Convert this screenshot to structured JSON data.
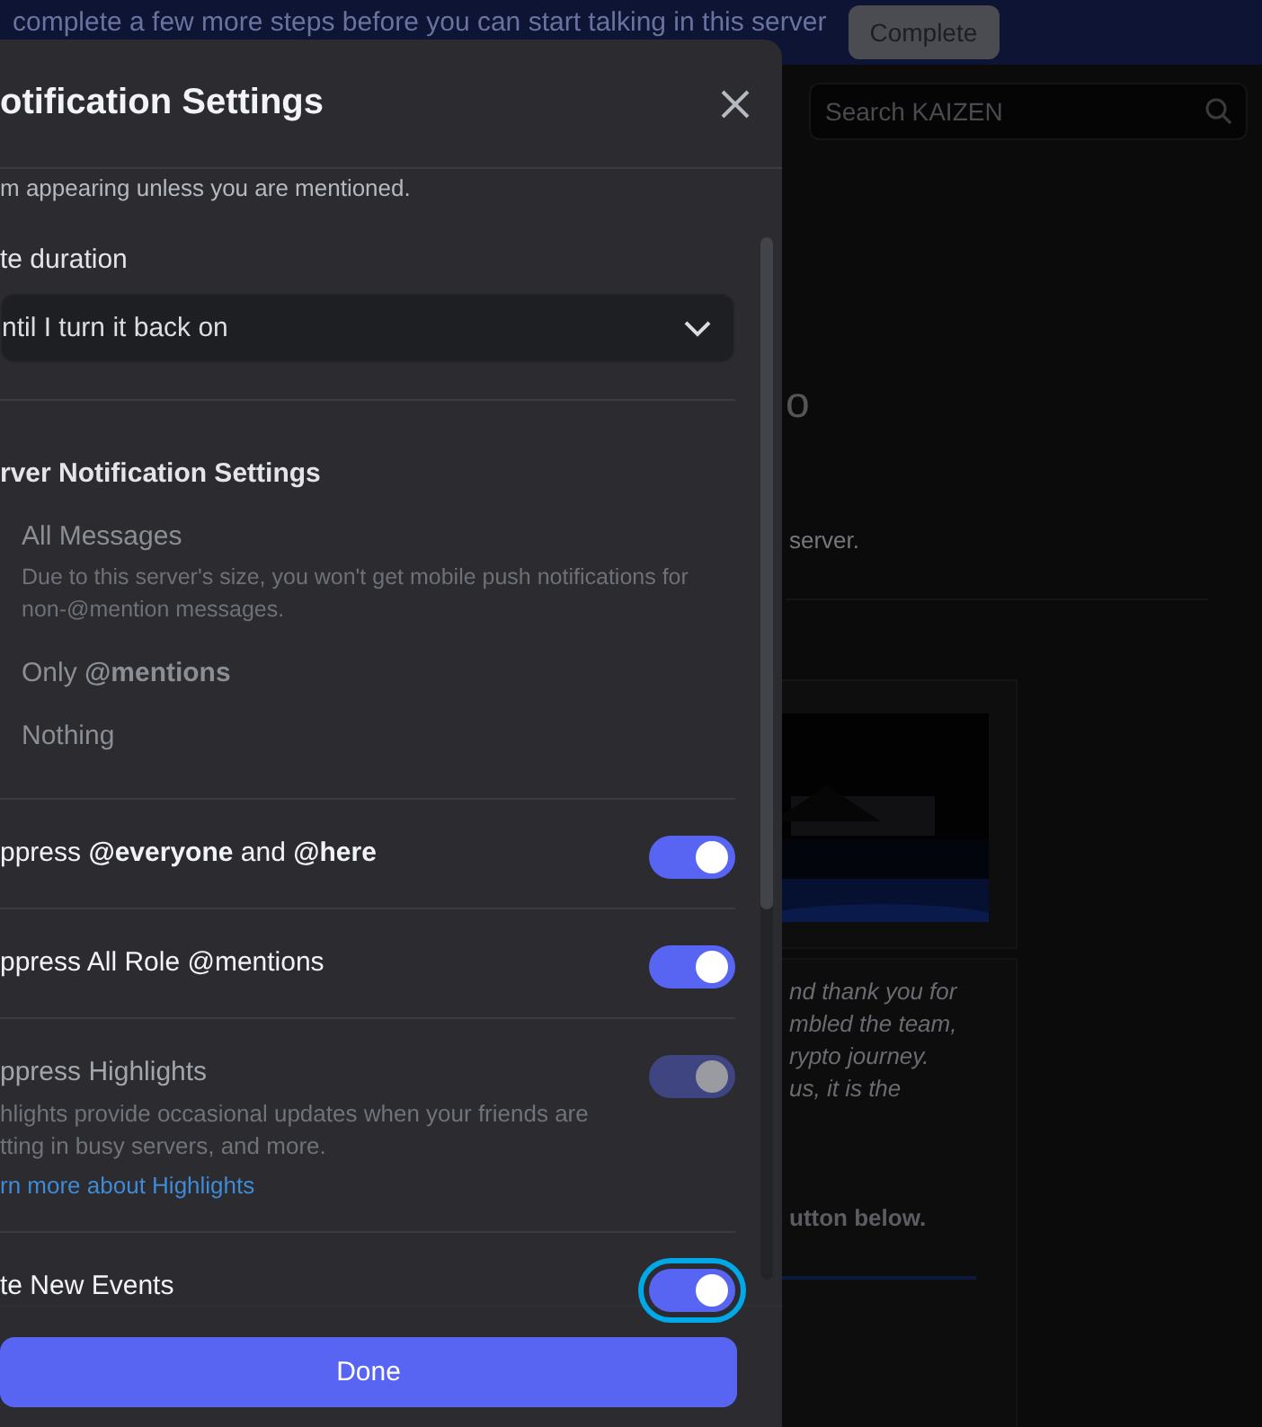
{
  "banner": {
    "message": "complete a few more steps before you can start talking in this server",
    "button": "Complete"
  },
  "search": {
    "placeholder": "Search KAIZEN"
  },
  "background": {
    "heading": "o",
    "subtitle": "server.",
    "message_lines": [
      "nd thank you for",
      "mbled the team,",
      "rypto journey.",
      "us, it is the"
    ],
    "footer_text": "utton below."
  },
  "modal": {
    "title": "otification Settings",
    "description": "m appearing unless you are mentioned.",
    "mute_duration": {
      "label": "te duration",
      "value": "ntil I turn it back on"
    },
    "section_title": "rver Notification Settings",
    "options": [
      {
        "label": "All Messages",
        "description": "Due to this server's size, you won't get mobile push notifications for non-@mention messages.",
        "disabled": true
      },
      {
        "label": "Only **@mentions**",
        "disabled": true
      },
      {
        "label": "Nothing",
        "disabled": true
      }
    ],
    "toggles": [
      {
        "label": "ppress **@everyone** and **@here**",
        "on": true,
        "disabled": false,
        "focused": false
      },
      {
        "label": "ppress All Role @mentions",
        "on": true,
        "disabled": false,
        "focused": false
      },
      {
        "label": "ppress Highlights",
        "on": true,
        "disabled": true,
        "focused": false,
        "description_lines": [
          "hlights provide occasional updates when your friends are",
          "tting in busy servers, and more."
        ],
        "link": "rn more about Highlights"
      },
      {
        "label": "te New Events",
        "on": true,
        "disabled": false,
        "focused": true
      }
    ],
    "done_button": "Done"
  }
}
